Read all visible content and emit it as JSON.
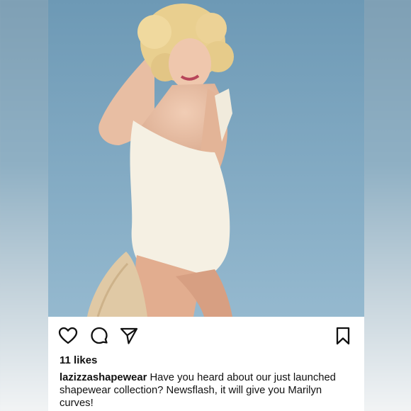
{
  "post": {
    "image": {
      "alt_icon": "photo-of-woman-in-white-swimsuit"
    },
    "actions": {
      "like_icon": "heart-icon",
      "comment_icon": "comment-icon",
      "share_icon": "send-icon",
      "save_icon": "bookmark-icon"
    },
    "likes_text": "11 likes",
    "caption": {
      "username": "lazizzashapewear",
      "text": " Have you heard about our just launched shapewear collection?  Newsflash, it will give you Marilyn curves!"
    }
  },
  "colors": {
    "sky": "#79a4bf",
    "text": "#111111",
    "background": "#ffffff"
  }
}
